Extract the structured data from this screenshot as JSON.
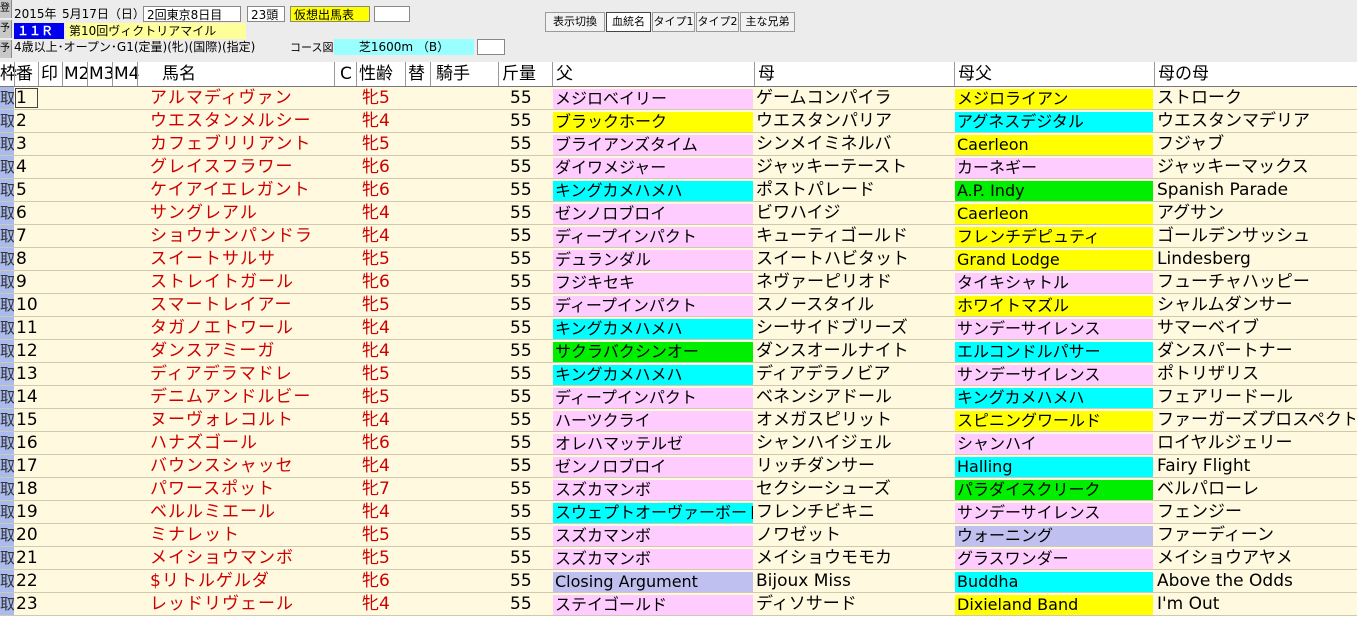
{
  "race": {
    "year": "2015年",
    "date": "5月17日（日）",
    "meeting": "2回東京8日目",
    "count": "23頭",
    "tentative": "仮想出馬表",
    "race_no": "１１Ｒ",
    "race_name": "第10回ヴィクトリアマイル",
    "conditions": "4歳以上･オープン･G1(定量)(牝)(国際)(指定)",
    "course_label": "コース図",
    "course": "芝1600m （B）"
  },
  "side_tabs": [
    "登",
    "予",
    "予"
  ],
  "buttons": [
    "表示切換",
    "血統名",
    "タイプ1",
    "タイプ2",
    "主な兄弟"
  ],
  "columns": {
    "waku": "枠",
    "ban": "番",
    "mark": "印",
    "m2": "M2",
    "m3": "M3",
    "m4": "M4",
    "name": "馬名",
    "c": "C",
    "sexage": "性齢",
    "kae": "替",
    "jockey": "騎手",
    "weight": "斤量",
    "sire": "父",
    "dam": "母",
    "damsire": "母父",
    "damdam": "母の母"
  },
  "colors": {
    "pink": "#ffccff",
    "yellow": "#ffff00",
    "cyan": "#00ffff",
    "green": "#00ee00",
    "lavender": "#c0c0f0",
    "white": "#ffffff",
    "name_red": "#cc0000",
    "row_bg": "#fff9e0"
  },
  "horses": [
    {
      "waku": "取",
      "no": "1",
      "name": "アルマディヴァン",
      "sexage": "牝5",
      "weight": "55",
      "sire": "メジロベイリー",
      "sire_c": "pink",
      "dam": "ゲームコンパイラ",
      "damsire": "メジロライアン",
      "damsire_c": "yellow",
      "damdam": "ストローク"
    },
    {
      "waku": "取",
      "no": "2",
      "name": "ウエスタンメルシー",
      "sexage": "牝4",
      "weight": "55",
      "sire": "ブラックホーク",
      "sire_c": "yellow",
      "dam": "ウエスタンパリア",
      "damsire": "アグネスデジタル",
      "damsire_c": "cyan",
      "damdam": "ウエスタンマデリア"
    },
    {
      "waku": "取",
      "no": "3",
      "name": "カフェブリリアント",
      "sexage": "牝5",
      "weight": "55",
      "sire": "ブライアンズタイム",
      "sire_c": "pink",
      "dam": "シンメイミネルバ",
      "damsire": "Caerleon",
      "damsire_c": "yellow",
      "damdam": "フジャブ"
    },
    {
      "waku": "取",
      "no": "4",
      "name": "グレイスフラワー",
      "sexage": "牝6",
      "weight": "55",
      "sire": "ダイワメジャー",
      "sire_c": "pink",
      "dam": "ジャッキーテースト",
      "damsire": "カーネギー",
      "damsire_c": "pink",
      "damdam": "ジャッキーマックス"
    },
    {
      "waku": "取",
      "no": "5",
      "name": "ケイアイエレガント",
      "sexage": "牝6",
      "weight": "55",
      "sire": "キングカメハメハ",
      "sire_c": "cyan",
      "dam": "ポストパレード",
      "damsire": "A.P. Indy",
      "damsire_c": "green",
      "damdam": "Spanish Parade"
    },
    {
      "waku": "取",
      "no": "6",
      "name": "サングレアル",
      "sexage": "牝4",
      "weight": "55",
      "sire": "ゼンノロブロイ",
      "sire_c": "pink",
      "dam": "ビワハイジ",
      "damsire": "Caerleon",
      "damsire_c": "yellow",
      "damdam": "アグサン"
    },
    {
      "waku": "取",
      "no": "7",
      "name": "ショウナンパンドラ",
      "sexage": "牝4",
      "weight": "55",
      "sire": "ディープインパクト",
      "sire_c": "pink",
      "dam": "キューティゴールド",
      "damsire": "フレンチデピュティ",
      "damsire_c": "yellow",
      "damdam": "ゴールデンサッシュ"
    },
    {
      "waku": "取",
      "no": "8",
      "name": "スイートサルサ",
      "sexage": "牝5",
      "weight": "55",
      "sire": "デュランダル",
      "sire_c": "pink",
      "dam": "スイートハビタット",
      "damsire": "Grand Lodge",
      "damsire_c": "yellow",
      "damdam": "Lindesberg"
    },
    {
      "waku": "取",
      "no": "9",
      "name": "ストレイトガール",
      "sexage": "牝6",
      "weight": "55",
      "sire": "フジキセキ",
      "sire_c": "pink",
      "dam": "ネヴァーピリオド",
      "damsire": "タイキシャトル",
      "damsire_c": "pink",
      "damdam": "フューチャハッピー"
    },
    {
      "waku": "取",
      "no": "10",
      "name": "スマートレイアー",
      "sexage": "牝5",
      "weight": "55",
      "sire": "ディープインパクト",
      "sire_c": "pink",
      "dam": "スノースタイル",
      "damsire": "ホワイトマズル",
      "damsire_c": "yellow",
      "damdam": "シャルムダンサー"
    },
    {
      "waku": "取",
      "no": "11",
      "name": "タガノエトワール",
      "sexage": "牝4",
      "weight": "55",
      "sire": "キングカメハメハ",
      "sire_c": "cyan",
      "dam": "シーサイドブリーズ",
      "damsire": "サンデーサイレンス",
      "damsire_c": "pink",
      "damdam": "サマーベイブ"
    },
    {
      "waku": "取",
      "no": "12",
      "name": "ダンスアミーガ",
      "sexage": "牝4",
      "weight": "55",
      "sire": "サクラバクシンオー",
      "sire_c": "green",
      "dam": "ダンスオールナイト",
      "damsire": "エルコンドルパサー",
      "damsire_c": "cyan",
      "damdam": "ダンスパートナー"
    },
    {
      "waku": "取",
      "no": "13",
      "name": "ディアデラマドレ",
      "sexage": "牝5",
      "weight": "55",
      "sire": "キングカメハメハ",
      "sire_c": "cyan",
      "dam": "ディアデラノビア",
      "damsire": "サンデーサイレンス",
      "damsire_c": "pink",
      "damdam": "ポトリザリス"
    },
    {
      "waku": "取",
      "no": "14",
      "name": "デニムアンドルビー",
      "sexage": "牝5",
      "weight": "55",
      "sire": "ディープインパクト",
      "sire_c": "pink",
      "dam": "ベネンシアドール",
      "damsire": "キングカメハメハ",
      "damsire_c": "cyan",
      "damdam": "フェアリードール"
    },
    {
      "waku": "取",
      "no": "15",
      "name": "ヌーヴォレコルト",
      "sexage": "牝4",
      "weight": "55",
      "sire": "ハーツクライ",
      "sire_c": "pink",
      "dam": "オメガスピリット",
      "damsire": "スピニングワールド",
      "damsire_c": "yellow",
      "damdam": "ファーガーズプロスペクト"
    },
    {
      "waku": "取",
      "no": "16",
      "name": "ハナズゴール",
      "sexage": "牝6",
      "weight": "55",
      "sire": "オレハマッテルゼ",
      "sire_c": "pink",
      "dam": "シャンハイジェル",
      "damsire": "シャンハイ",
      "damsire_c": "pink",
      "damdam": "ロイヤルジェリー"
    },
    {
      "waku": "取",
      "no": "17",
      "name": "バウンスシャッセ",
      "sexage": "牝4",
      "weight": "55",
      "sire": "ゼンノロブロイ",
      "sire_c": "pink",
      "dam": "リッチダンサー",
      "damsire": "Halling",
      "damsire_c": "cyan",
      "damdam": "Fairy Flight"
    },
    {
      "waku": "取",
      "no": "18",
      "name": "パワースポット",
      "sexage": "牝7",
      "weight": "55",
      "sire": "スズカマンボ",
      "sire_c": "pink",
      "dam": "セクシーシューズ",
      "damsire": "パラダイスクリーク",
      "damsire_c": "green",
      "damdam": "ベルパローレ"
    },
    {
      "waku": "取",
      "no": "19",
      "name": "ベルルミエール",
      "sexage": "牝4",
      "weight": "55",
      "sire": "スウェプトオーヴァーボード",
      "sire_c": "cyan",
      "dam": "フレンチビキニ",
      "damsire": "サンデーサイレンス",
      "damsire_c": "pink",
      "damdam": "フェンジー"
    },
    {
      "waku": "取",
      "no": "20",
      "name": "ミナレット",
      "sexage": "牝5",
      "weight": "55",
      "sire": "スズカマンボ",
      "sire_c": "pink",
      "dam": "ノワゼット",
      "damsire": "ウォーニング",
      "damsire_c": "lavender",
      "damdam": "ファーディーン"
    },
    {
      "waku": "取",
      "no": "21",
      "name": "メイショウマンボ",
      "sexage": "牝5",
      "weight": "55",
      "sire": "スズカマンボ",
      "sire_c": "pink",
      "dam": "メイショウモモカ",
      "damsire": "グラスワンダー",
      "damsire_c": "pink",
      "damdam": "メイショウアヤメ"
    },
    {
      "waku": "取",
      "no": "22",
      "name": "$リトルゲルダ",
      "sexage": "牝6",
      "weight": "55",
      "sire": "Closing Argument",
      "sire_c": "lavender",
      "dam": "Bijoux Miss",
      "damsire": "Buddha",
      "damsire_c": "cyan",
      "damdam": "Above the Odds"
    },
    {
      "waku": "取",
      "no": "23",
      "name": "レッドリヴェール",
      "sexage": "牝4",
      "weight": "55",
      "sire": "ステイゴールド",
      "sire_c": "pink",
      "dam": "ディソサード",
      "damsire": "Dixieland Band",
      "damsire_c": "yellow",
      "damdam": "I'm Out"
    }
  ]
}
